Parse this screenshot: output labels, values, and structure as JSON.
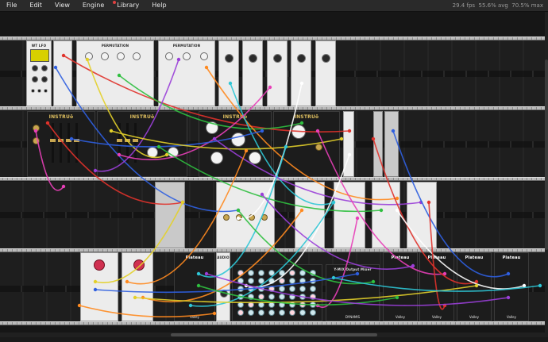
{
  "menubar": {
    "items": [
      "File",
      "Edit",
      "View",
      "Engine",
      "Library",
      "Help"
    ],
    "status": "29.4 fps  55.6% avg  70.5% max"
  },
  "modules": {
    "lfo_title": "WT LFO",
    "permutation_title": "PERMUTATION",
    "instruo_brand": "INSTRUō",
    "mixer_title": "Y-MIX Output Mixer",
    "plateau_title": "Plateau",
    "valley_label": "Valley",
    "audio_label": "AUDIO",
    "dynamis_label": "DYNAMIS"
  },
  "colors": {
    "cables": [
      "#e0322b",
      "#2f5fe0",
      "#e3d02a",
      "#2fbf3f",
      "#9a3fd8",
      "#ff8a1f",
      "#2ec6d6",
      "#e83fb8",
      "#ffffff"
    ]
  }
}
